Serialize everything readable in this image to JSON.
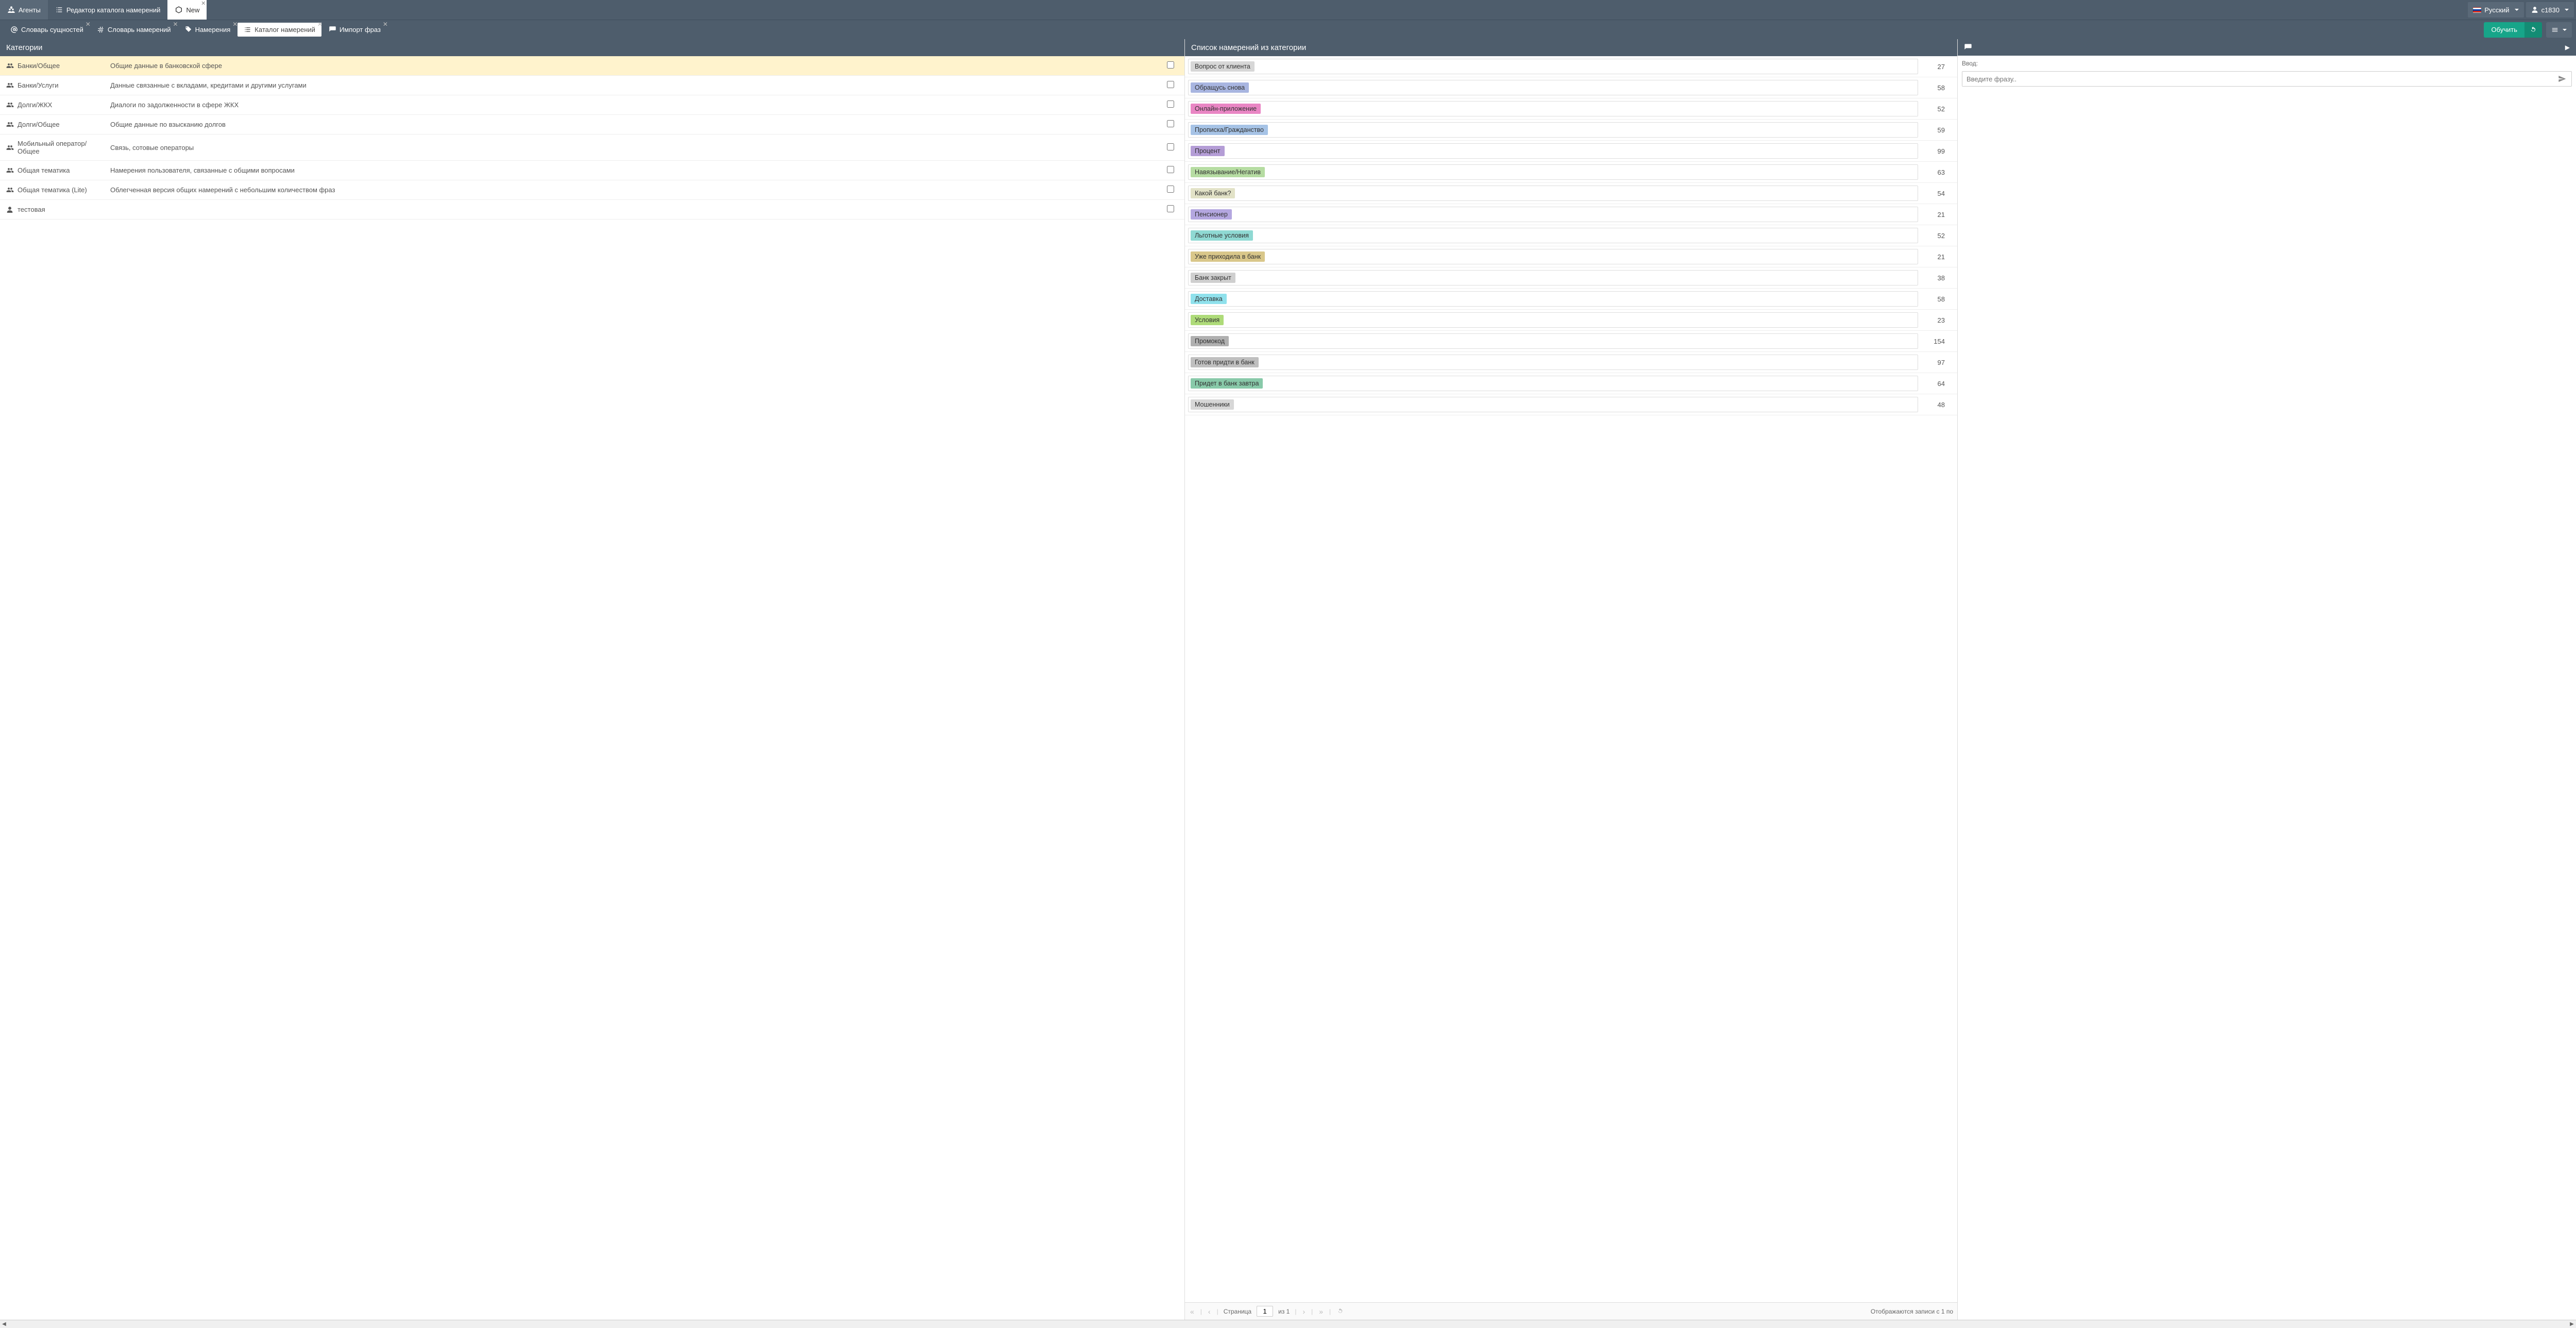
{
  "top_nav": {
    "agents": "Агенты",
    "catalog_editor": "Редактор каталога намерений",
    "new_tab": "New"
  },
  "nav_right": {
    "language": "Русский",
    "user": "c1830"
  },
  "sub_tabs": {
    "entity_dict": "Словарь сущностей",
    "intent_dict": "Словарь намерений",
    "intents": "Намерения",
    "intent_catalog": "Каталог намерений",
    "import_phrases": "Импорт фраз"
  },
  "buttons": {
    "teach": "Обучить"
  },
  "panels": {
    "categories_title": "Категории",
    "intent_list_title": "Список намерений из категории",
    "input_label": "Ввод:",
    "phrase_placeholder": "Введите фразу.."
  },
  "categories": [
    {
      "icon": "group",
      "name": "Банки/Общее",
      "desc": "Общие данные в банковской сфере",
      "selected": true
    },
    {
      "icon": "group",
      "name": "Банки/Услуги",
      "desc": "Данные связанные с вкладами, кредитами и другими услугами",
      "selected": false
    },
    {
      "icon": "group",
      "name": "Долги/ЖКХ",
      "desc": "Диалоги по задолженности в сфере ЖКХ",
      "selected": false
    },
    {
      "icon": "group",
      "name": "Долги/Общее",
      "desc": "Общие данные по взысканию долгов",
      "selected": false
    },
    {
      "icon": "group",
      "name": "Мобильный оператор/Общее",
      "desc": "Связь, сотовые операторы",
      "selected": false
    },
    {
      "icon": "group",
      "name": "Общая тематика",
      "desc": "Намерения пользователя, связанные с общими вопросами",
      "selected": false
    },
    {
      "icon": "group",
      "name": "Общая тематика (Lite)",
      "desc": "Облегченная версия общих намерений с небольшим количеством фраз",
      "selected": false
    },
    {
      "icon": "user",
      "name": "тестовая",
      "desc": "",
      "selected": false
    }
  ],
  "intents": [
    {
      "label": "Вопрос от клиента",
      "color": "#d7d7d7",
      "count": 27
    },
    {
      "label": "Обращусь снова",
      "color": "#a8b5e0",
      "count": 58
    },
    {
      "label": "Онлайн-приложение",
      "color": "#e986c4",
      "count": 52
    },
    {
      "label": "Прописка/Гражданство",
      "color": "#a6c3e6",
      "count": 59
    },
    {
      "label": "Процент",
      "color": "#b49dd6",
      "count": 99
    },
    {
      "label": "Навязывание/Негатив",
      "color": "#b6dca2",
      "count": 63
    },
    {
      "label": "Какой банк?",
      "color": "#e2e2c7",
      "count": 54
    },
    {
      "label": "Пенсионер",
      "color": "#b4a7e0",
      "count": 21
    },
    {
      "label": "Льготные условия",
      "color": "#8fd9d3",
      "count": 52
    },
    {
      "label": "Уже приходила в банк",
      "color": "#d9c78a",
      "count": 21
    },
    {
      "label": "Банк закрыт",
      "color": "#cfcfcf",
      "count": 38
    },
    {
      "label": "Доставка",
      "color": "#8fe1ec",
      "count": 58
    },
    {
      "label": "Условия",
      "color": "#aedb79",
      "count": 23
    },
    {
      "label": "Промокод",
      "color": "#b0b0b0",
      "count": 154
    },
    {
      "label": "Готов придти в банк",
      "color": "#bfbfbf",
      "count": 97
    },
    {
      "label": "Придет в банк завтра",
      "color": "#88c9a9",
      "count": 64
    },
    {
      "label": "Мошенники",
      "color": "#d7d7d7",
      "count": 48
    }
  ],
  "pager": {
    "page_label": "Страница",
    "current": "1",
    "of_label": "из 1",
    "status": "Отображаются записи с 1 по"
  }
}
